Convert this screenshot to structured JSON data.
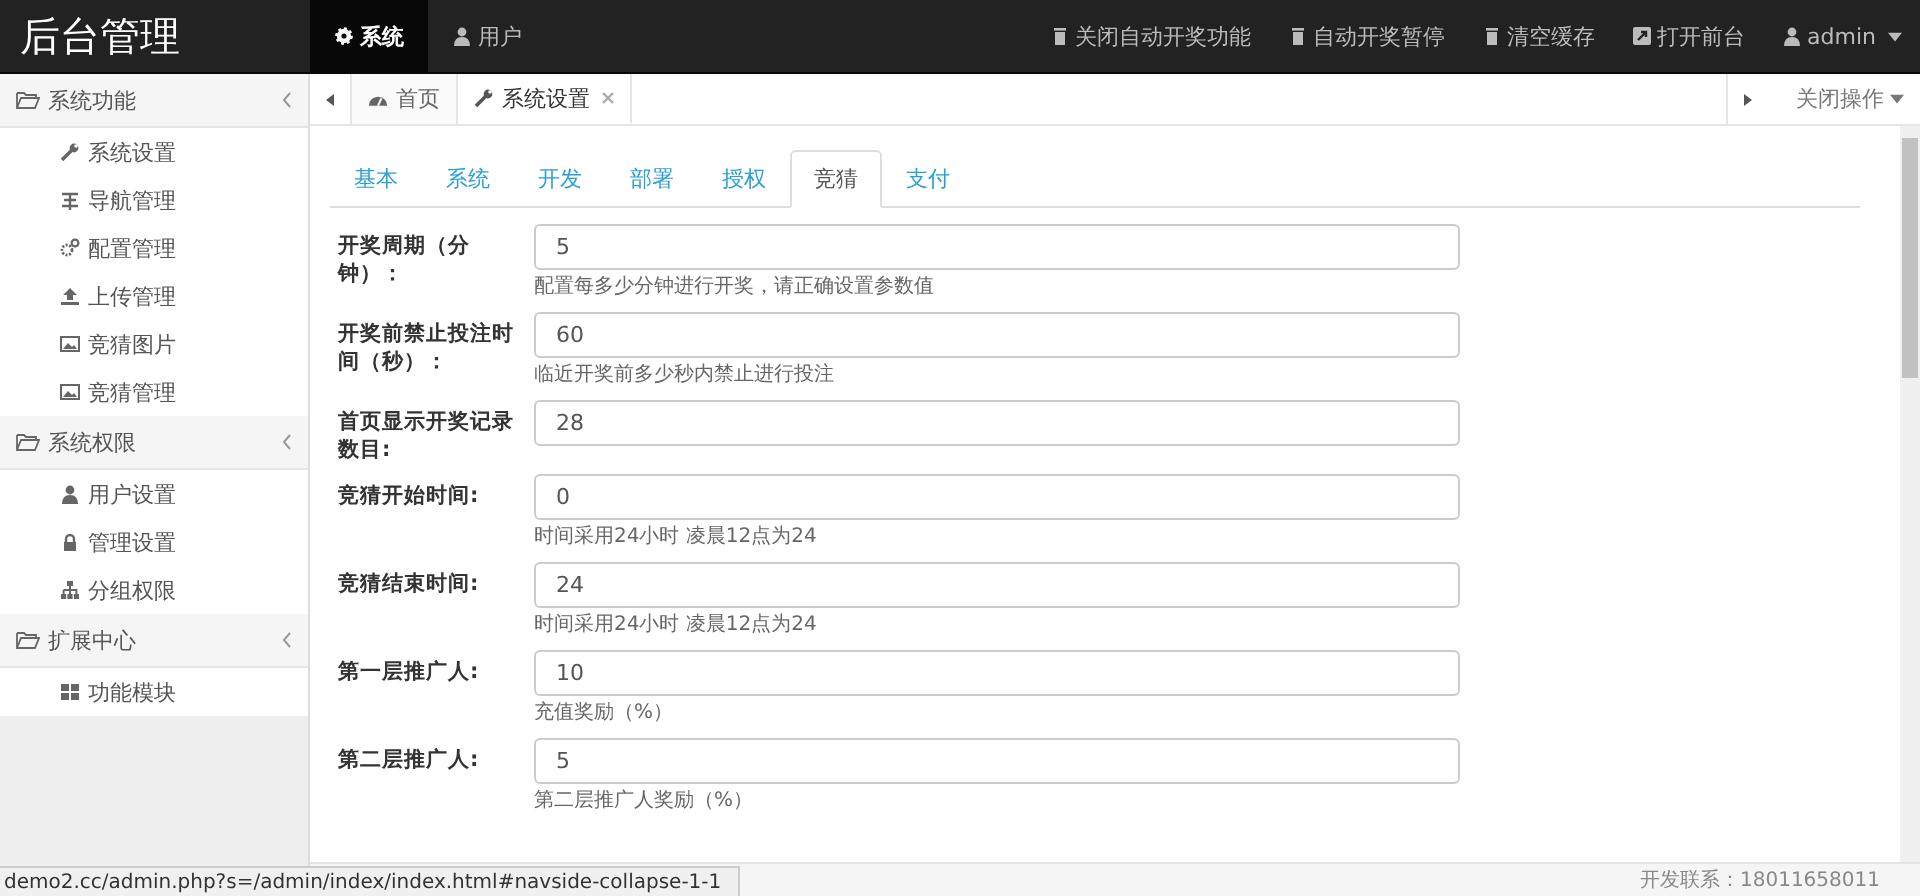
{
  "brand": "后台管理",
  "top_nav": [
    {
      "label": "系统",
      "kind": "gear",
      "selected": true
    },
    {
      "label": "用户",
      "kind": "user",
      "selected": false
    }
  ],
  "top_actions": [
    {
      "label": "关闭自动开奖功能",
      "kind": "trash"
    },
    {
      "label": "自动开奖暂停",
      "kind": "trash"
    },
    {
      "label": "清空缓存",
      "kind": "trash"
    },
    {
      "label": "打开前台",
      "kind": "external"
    },
    {
      "label": "admin",
      "kind": "account"
    }
  ],
  "sidebar": {
    "groups": [
      {
        "label": "系统功能",
        "items": [
          {
            "label": "系统设置",
            "kind": "wrench"
          },
          {
            "label": "导航管理",
            "kind": "list"
          },
          {
            "label": "配置管理",
            "kind": "cogs"
          },
          {
            "label": "上传管理",
            "kind": "upload"
          },
          {
            "label": "竞猜图片",
            "kind": "image"
          },
          {
            "label": "竞猜管理",
            "kind": "image"
          }
        ]
      },
      {
        "label": "系统权限",
        "items": [
          {
            "label": "用户设置",
            "kind": "user"
          },
          {
            "label": "管理设置",
            "kind": "lock"
          },
          {
            "label": "分组权限",
            "kind": "sitemap"
          }
        ]
      },
      {
        "label": "扩展中心",
        "items": [
          {
            "label": "功能模块",
            "kind": "grid"
          }
        ]
      }
    ]
  },
  "page_tabs": [
    {
      "label": "首页",
      "kind": "dashboard",
      "closable": false,
      "selected": false
    },
    {
      "label": "系统设置",
      "kind": "wrench",
      "closable": true,
      "selected": true
    }
  ],
  "close_menu": "关闭操作",
  "settings_tabs": [
    {
      "label": "基本",
      "selected": false
    },
    {
      "label": "系统",
      "selected": false
    },
    {
      "label": "开发",
      "selected": false
    },
    {
      "label": "部署",
      "selected": false
    },
    {
      "label": "授权",
      "selected": false
    },
    {
      "label": "竞猜",
      "selected": true
    },
    {
      "label": "支付",
      "selected": false
    }
  ],
  "fields": [
    {
      "label": "开奖周期（分钟）：",
      "value": "5",
      "help": "配置每多少分钟进行开奖，请正确设置参数值"
    },
    {
      "label": "开奖前禁止投注时间（秒）：",
      "value": "60",
      "help": "临近开奖前多少秒内禁止进行投注"
    },
    {
      "label": "首页显示开奖记录数目:",
      "value": "28"
    },
    {
      "label": "竞猜开始时间:",
      "value": "0",
      "help": "时间采用24小时 凌晨12点为24"
    },
    {
      "label": "竞猜结束时间:",
      "value": "24",
      "help": "时间采用24小时 凌晨12点为24"
    },
    {
      "label": "第一层推广人:",
      "value": "10",
      "help": "充值奖励（%）"
    },
    {
      "label": "第二层推广人:",
      "value": "5",
      "help": "第二层推广人奖励（%）"
    }
  ],
  "status_url": "demo2.cc/admin.php?s=/admin/index/index.html#navside-collapse-1-1",
  "footer_contact": "开发联系：18011658011"
}
